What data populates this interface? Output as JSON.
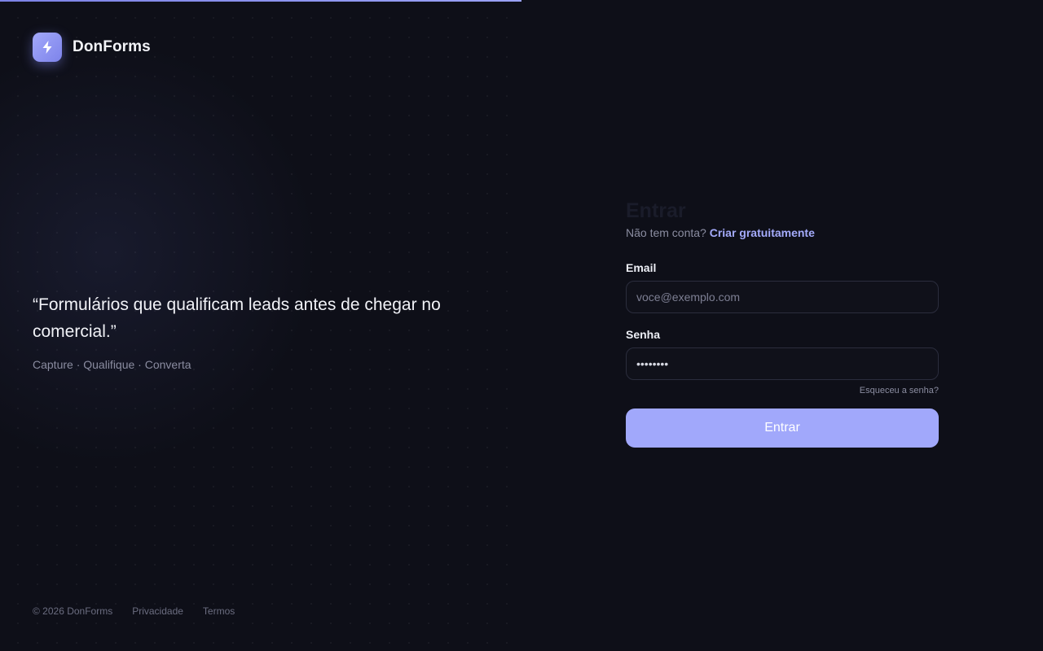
{
  "brand": {
    "name": "DonForms",
    "icon": "lightning-bolt-icon"
  },
  "hero": {
    "quote": "“Formulários que qualificam leads antes de chegar no comercial.”",
    "tagline": "Capture · Qualifique · Converta"
  },
  "footer": {
    "copyright": "© 2026 DonForms",
    "privacy": "Privacidade",
    "terms": "Termos"
  },
  "login": {
    "title": "Entrar",
    "no_account": "Não tem conta?",
    "signup_link": "Criar gratuitamente",
    "email_label": "Email",
    "email_placeholder": "voce@exemplo.com",
    "email_value": "",
    "password_label": "Senha",
    "password_value": "••••••••",
    "forgot_link": "Esqueceu a senha?",
    "submit_label": "Entrar"
  },
  "colors": {
    "accent": "#a1a8fb",
    "background": "#0e0f18"
  }
}
